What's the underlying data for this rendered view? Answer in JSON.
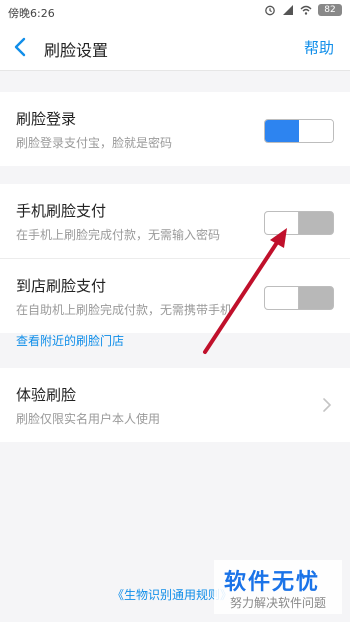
{
  "status_bar": {
    "time": "傍晚6:26",
    "battery": "82"
  },
  "header": {
    "title": "刷脸设置",
    "help": "帮助"
  },
  "sections": {
    "login": {
      "title": "刷脸登录",
      "subtitle": "刷脸登录支付宝，脸就是密码",
      "toggle": "on"
    },
    "mobile_pay": {
      "title": "手机刷脸支付",
      "subtitle": "在手机上刷脸完成付款，无需输入密码",
      "toggle": "off"
    },
    "store_pay": {
      "title": "到店刷脸支付",
      "subtitle": "在自助机上刷脸完成付款，无需携带手机",
      "toggle": "off"
    },
    "nearby_link": "查看附近的刷脸门店",
    "experience": {
      "title": "体验刷脸",
      "subtitle": "刷脸仅限实名用户本人使用"
    }
  },
  "footer": {
    "link": "《生物识别通用规则》"
  },
  "watermark": {
    "logo": "软件无忧",
    "sub": "努力解决软件问题"
  },
  "colors": {
    "accent": "#108ee9",
    "toggle_on": "#2d84f0",
    "arrow": "#c0102b"
  }
}
